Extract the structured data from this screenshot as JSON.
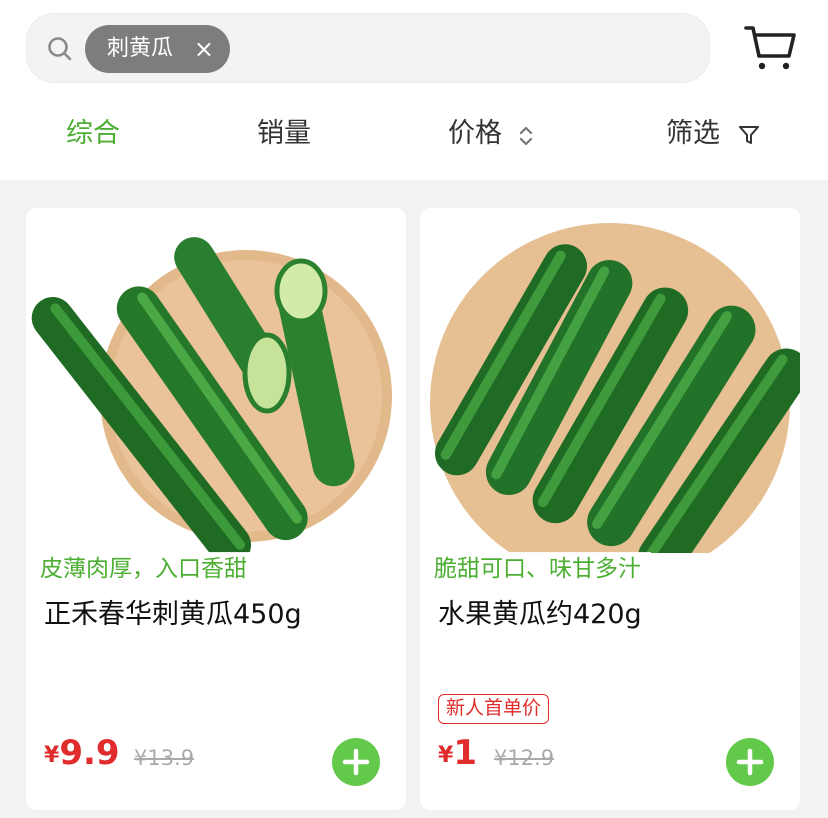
{
  "search": {
    "tag_label": "刺黄瓜",
    "tag_close": "×"
  },
  "sort_tabs": [
    {
      "label": "综合",
      "active": true
    },
    {
      "label": "销量",
      "active": false
    },
    {
      "label": "价格",
      "active": false
    },
    {
      "label": "筛选",
      "active": false
    }
  ],
  "icons": {
    "search": "search-icon",
    "cart": "cart-icon",
    "sort": "sort-arrows-icon",
    "filter": "filter-icon",
    "add": "plus-icon"
  },
  "colors": {
    "accent_green": "#4caf33",
    "price_red": "#e02c2c",
    "add_button": "#62c94b"
  },
  "products": [
    {
      "slogan": "皮薄肉厚，入口香甜",
      "name": "正禾春华刺黄瓜450g",
      "badge": "",
      "currency": "¥",
      "price": "9.9",
      "original_price": "¥13.9"
    },
    {
      "slogan": "脆甜可口、味甘多汁",
      "name": "水果黄瓜约420g",
      "badge": "新人首单价",
      "currency": "¥",
      "price": "1",
      "original_price": "¥12.9"
    }
  ]
}
